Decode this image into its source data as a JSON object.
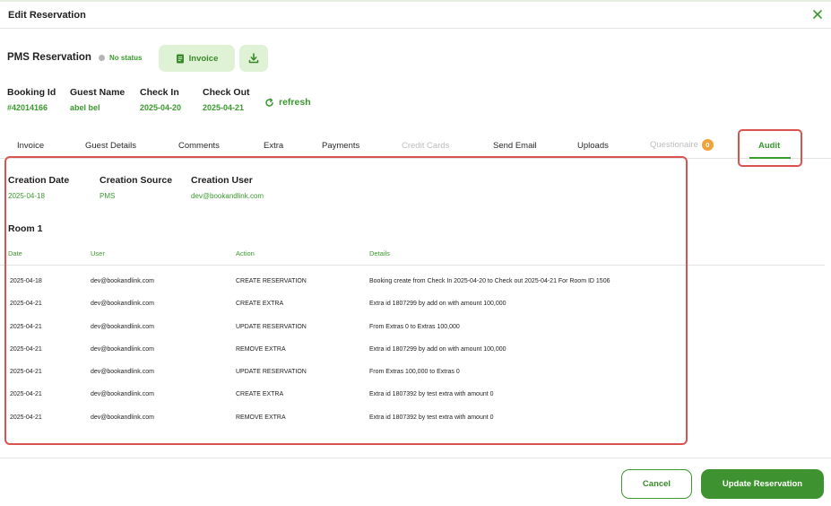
{
  "window": {
    "title": "Edit Reservation"
  },
  "pms": {
    "title": "PMS Reservation",
    "status": "No status",
    "invoice_label": "Invoice"
  },
  "booking": {
    "booking_id_label": "Booking Id",
    "booking_id": "#42014166",
    "guest_name_label": "Guest Name",
    "guest_name": "abel bel",
    "check_in_label": "Check In",
    "check_in": "2025-04-20",
    "check_out_label": "Check Out",
    "check_out": "2025-04-21",
    "refresh_label": "refresh"
  },
  "tabs": [
    {
      "label": "Invoice",
      "state": "normal"
    },
    {
      "label": "Guest Details",
      "state": "normal"
    },
    {
      "label": "Comments",
      "state": "normal"
    },
    {
      "label": "Extra",
      "state": "normal"
    },
    {
      "label": "Payments",
      "state": "normal"
    },
    {
      "label": "Credit Cards",
      "state": "disabled"
    },
    {
      "label": "Send Email",
      "state": "normal"
    },
    {
      "label": "Uploads",
      "state": "normal"
    },
    {
      "label": "Questionaire",
      "state": "disabled",
      "badge": "0"
    },
    {
      "label": "Audit",
      "state": "active"
    }
  ],
  "creation": {
    "date_label": "Creation Date",
    "date": "2025-04-18",
    "source_label": "Creation Source",
    "source": "PMS",
    "user_label": "Creation User",
    "user": "dev@bookandlink.com"
  },
  "room": {
    "title": "Room 1",
    "columns": [
      "Date",
      "User",
      "Action",
      "Details"
    ],
    "rows": [
      [
        "2025-04-18",
        "dev@bookandlink.com",
        "CREATE RESERVATION",
        "Booking create from Check In 2025-04-20 to Check out 2025-04-21 For Room ID 1506"
      ],
      [
        "2025-04-21",
        "dev@bookandlink.com",
        "CREATE EXTRA",
        "Extra id 1807299 by add on with amount 100,000"
      ],
      [
        "2025-04-21",
        "dev@bookandlink.com",
        "UPDATE RESERVATION",
        "From Extras 0 to Extras 100,000"
      ],
      [
        "2025-04-21",
        "dev@bookandlink.com",
        "REMOVE EXTRA",
        "Extra id 1807299 by add on with amount 100,000"
      ],
      [
        "2025-04-21",
        "dev@bookandlink.com",
        "UPDATE RESERVATION",
        "From Extras 100,000 to Extras 0"
      ],
      [
        "2025-04-21",
        "dev@bookandlink.com",
        "CREATE EXTRA",
        "Extra id 1807392 by test extra with amount 0"
      ],
      [
        "2025-04-21",
        "dev@bookandlink.com",
        "REMOVE EXTRA",
        "Extra id 1807392 by test extra with amount 0"
      ]
    ]
  },
  "footer": {
    "cancel_label": "Cancel",
    "update_label": "Update Reservation"
  },
  "colors": {
    "accent": "#3a9a2e",
    "accent_light": "#dff2d6",
    "highlight": "#d9534f",
    "badge": "#f2a23a"
  },
  "icons": {
    "close": "close-icon",
    "invoice": "document-icon",
    "download": "download-icon",
    "refresh": "refresh-icon"
  }
}
